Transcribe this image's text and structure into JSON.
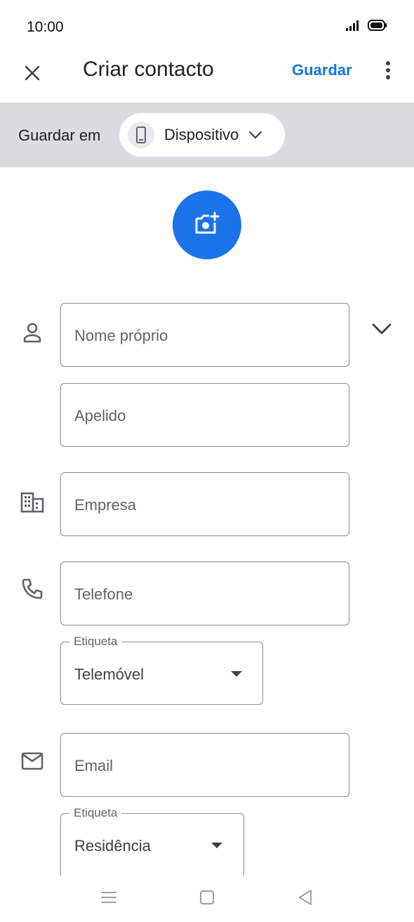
{
  "status_bar": {
    "time": "10:00",
    "icons": [
      "signal-icon",
      "battery-icon"
    ]
  },
  "app_bar": {
    "title": "Criar contacto",
    "save_label": "Guardar",
    "icons": [
      "close-icon",
      "more-vert-icon"
    ]
  },
  "save_location": {
    "label": "Guardar em",
    "account": "Dispositivo",
    "icons": [
      "phone-device-icon",
      "chevron-down-icon"
    ]
  },
  "photo": {
    "icon": "add-photo-icon",
    "accent_color": "#1a73e8"
  },
  "form": {
    "first_name_placeholder": "Nome próprio",
    "last_name_placeholder": "Apelido",
    "company_placeholder": "Empresa",
    "phone_placeholder": "Telefone",
    "phone_label_legend": "Etiqueta",
    "phone_label_value": "Telemóvel",
    "email_placeholder": "Email",
    "email_label_legend": "Etiqueta",
    "email_label_value": "Residência",
    "icons": [
      "person-icon",
      "business-icon",
      "phone-icon",
      "mail-icon",
      "expand-more-icon"
    ]
  },
  "nav_bar": {
    "icons": [
      "menu-icon",
      "home-square-icon",
      "back-triangle-icon"
    ]
  }
}
